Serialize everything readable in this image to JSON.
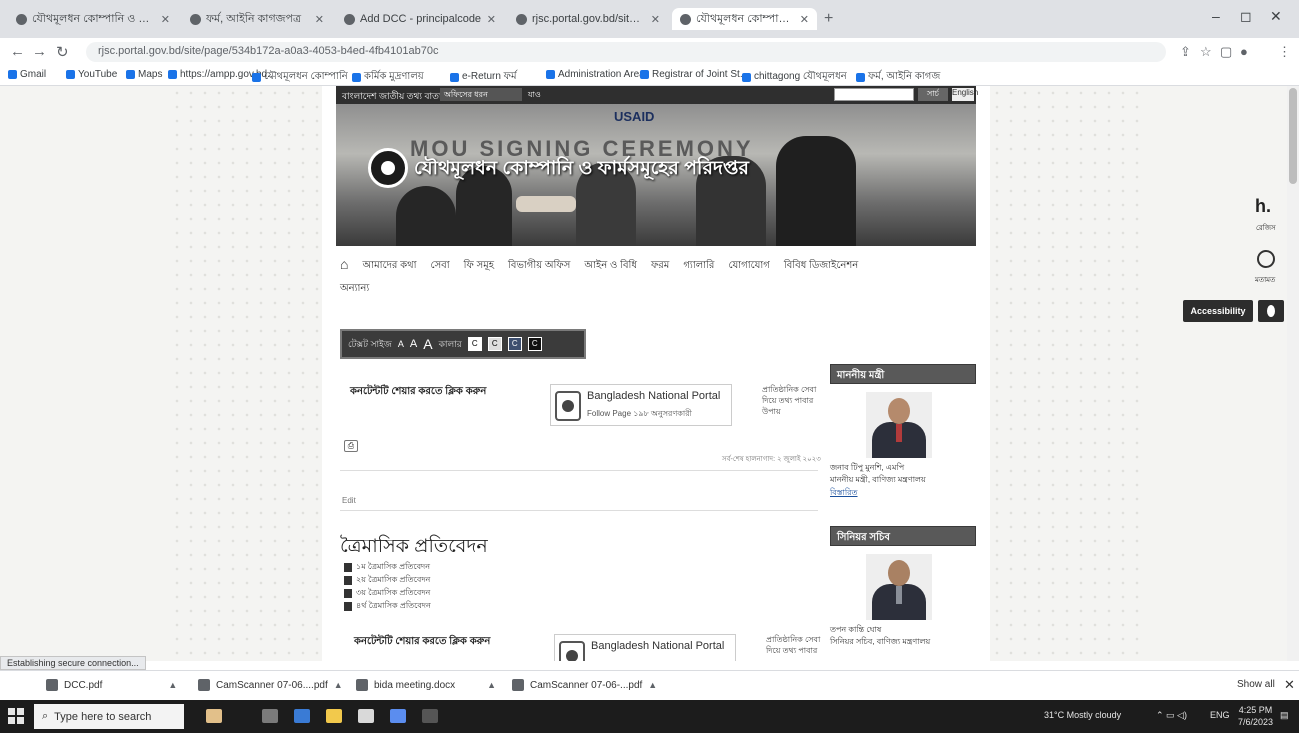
{
  "browser": {
    "tabs": [
      {
        "title": "যৌথমূলধন কোম্পানি ও ফার্মসমূহ"
      },
      {
        "title": "ফর্ম, আইনি কাগজপত্র"
      },
      {
        "title": "Add DCC - principalcode"
      },
      {
        "title": "rjsc.portal.gov.bd/site/page"
      },
      {
        "title": "যৌথমূলধন কোম্পানি ও ফার্মসমূহ",
        "active": true
      }
    ],
    "new_tab": "+",
    "window_controls": {
      "minimize": "–",
      "restore": "◻",
      "close": "✕"
    },
    "url": "rjsc.portal.gov.bd/site/page/534b172a-a0a3-4053-b4ed-4fb4101ab70c",
    "bookmarks": [
      "Gmail",
      "YouTube",
      "Maps",
      "https://ampp.gov.bd...",
      "যৌথমূলধন কোম্পানি",
      "কর্মিক মুদ্রণালয়",
      "e-Return ফর্ম",
      "Administration Area",
      "Registrar of Joint St...",
      "chittagong যৌথমূলধন",
      "ফর্ম, আইনি কাগজ"
    ]
  },
  "site": {
    "top_strip": {
      "title": "বাংলাদেশ জাতীয় তথ্য বাতায়ন",
      "select_label": "অফিসের ধরন",
      "go_label": "যাও",
      "search_button": "সার্চ",
      "lang_button": "English"
    },
    "banner": {
      "bg_text": "MOU SIGNING CEREMONY",
      "usaid": "USAID",
      "department_name": "যৌথমূলধন কোম্পানি ও ফার্মসমূহের পরিদপ্তর"
    },
    "nav": {
      "items": [
        "আমাদের কথা",
        "সেবা",
        "ফি সমূহ",
        "বিভাগীয় অফিস",
        "আইন ও বিধি",
        "ফরম",
        "গ্যালারি",
        "যোগাযোগ",
        "বিবিধ ডিজাইনেশন",
        "অন্যান্য"
      ]
    },
    "accessibility_bar": {
      "text_size_label": "টেক্সট সাইজ",
      "sizes": [
        "A",
        "A",
        "A"
      ],
      "color_label": "কালার",
      "swatches": [
        "C",
        "C",
        "C",
        "C"
      ]
    },
    "content_block_1": {
      "heading": "কনটেন্টটি শেয়ার করতে ক্লিক করুন",
      "np_title": "Bangladesh National Portal",
      "np_follow": "Follow Page",
      "np_followers": "১৯৮ অনুসরণকারী",
      "np_side": [
        "প্রাতিষ্ঠানিক সেবা",
        "দিয়ে তথ্য পাবার",
        "উপায়"
      ],
      "updated": "সর্ব-শেষ হালনাগাদ: ২ জুলাই ২০২৩",
      "share_label": "Edit"
    },
    "section": {
      "title": "ত্রৈমাসিক প্রতিবেদন",
      "documents": [
        "১ম ত্রৈমাসিক প্রতিবেদন",
        "২য় ত্রৈমাসিক প্রতিবেদন",
        "৩য় ত্রৈমাসিক প্রতিবেদন",
        "৪র্থ ত্রৈমাসিক প্রতিবেদন"
      ]
    },
    "content_block_2": {
      "heading": "কনটেন্টটি শেয়ার করতে ক্লিক করুন",
      "np_title": "Bangladesh National Portal",
      "np_side": [
        "প্রাতিষ্ঠানিক সেবা",
        "দিয়ে তথ্য পাবার"
      ]
    },
    "sidebar": {
      "minister": {
        "heading": "মাননীয় মন্ত্রী",
        "name": "জনাব টিপু মুনশি, এমপি",
        "role": "মাননীয় মন্ত্রী, বাণিজ্য মন্ত্রণালয়",
        "link": "বিস্তারিত"
      },
      "secretary": {
        "heading": "সিনিয়র সচিব",
        "name": "তপন কান্তি ঘোষ",
        "role": "সিনিয়র সচিব, বাণিজ্য মন্ত্রণালয়"
      }
    },
    "float_widgets": {
      "logo": "h.",
      "logo_label": "রেজিস",
      "chat_label": "মতামত",
      "accessibility_button": "Accessibility"
    }
  },
  "status": {
    "text": "Establishing secure connection..."
  },
  "downloads": {
    "items": [
      {
        "name": "DCC.pdf"
      },
      {
        "name": "CamScanner 07-06....pdf"
      },
      {
        "name": "bida meeting.docx"
      },
      {
        "name": "CamScanner 07-06-...pdf"
      }
    ],
    "show_all": "Show all",
    "close": "✕"
  },
  "taskbar": {
    "search_placeholder": "Type here to search",
    "weather": "31°C  Mostly cloudy",
    "lang": "ENG",
    "time": "4:25 PM",
    "date": "7/6/2023"
  }
}
